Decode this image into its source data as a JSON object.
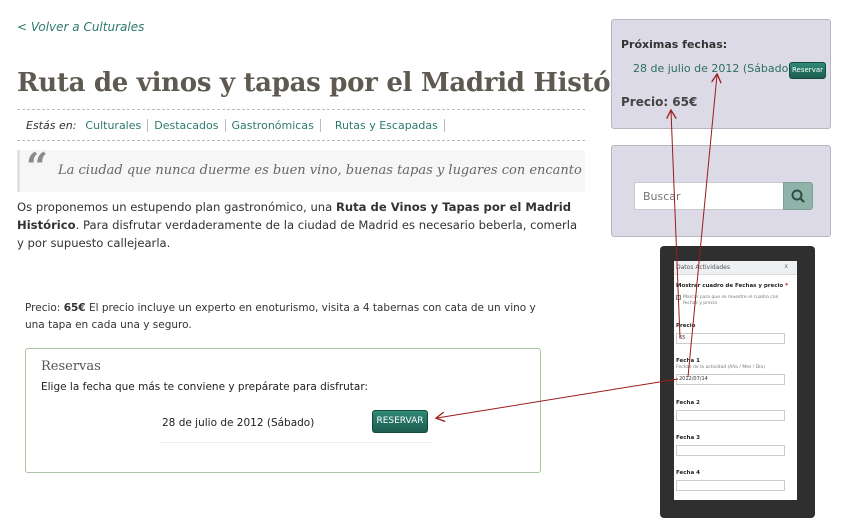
{
  "nav": {
    "back_link": "< Volver a Culturales"
  },
  "article": {
    "title": "Ruta de vinos y tapas por el Madrid Histórico",
    "categories_label": "Estás en:",
    "categories": [
      "Culturales",
      "Destacados",
      "Gastronómicas",
      "Rutas y Escapadas"
    ],
    "quote": "La ciudad que nunca duerme es buen vino, buenas tapas y lugares con encanto",
    "intro_a": "Os proponemos un estupendo plan gastronómico, una ",
    "intro_bold": "Ruta de Vinos y Tapas por el Madrid Histórico",
    "intro_b": ". Para disfrutar verdaderamente de la ciudad de Madrid es necesario beberla, comerla y por supuesto callejearla.",
    "price_label": "Precio: ",
    "price_value": "65€",
    "price_desc": " El precio incluye un experto en enoturismo, visita a 4 tabernas con cata de un vino y una tapa en cada una y seguro."
  },
  "reservas": {
    "title": "Reservas",
    "subtitle": "Elige la fecha que más te conviene y prepárate para disfrutar:",
    "date": "28 de julio de 2012 (Sábado)",
    "button": "RESERVAR"
  },
  "sidebar": {
    "next_dates_title": "Próximas fechas:",
    "date": "28 de julio de 2012 (Sábado)",
    "button": "Reservar",
    "price": "Precio: 65€",
    "search_placeholder": "Buscar"
  },
  "admin_panel": {
    "header": "Datos Actividades",
    "close": "x",
    "show_box_label": "Mostrar cuadro de Fechas y precio",
    "required_mark": "*",
    "checkbox_text_1": "Marcar para que se muestre el cuadro con",
    "checkbox_text_2": "fechas y precio",
    "price_label": "Precio",
    "price_value": "65",
    "fecha1_label": "Fecha 1",
    "fecha1_help": "Fechas de la actividad (Año / Mes / Día)",
    "fecha1_value": "2012/07/14",
    "fecha2_label": "Fecha 2",
    "fecha3_label": "Fecha 3",
    "fecha4_label": "Fecha 4"
  },
  "colors": {
    "link": "#2d7a6e",
    "button": "#1d5c4e",
    "sidebar_bg": "#dcdae6",
    "arrow": "#9b1b1b",
    "tablet": "#2f2f2f"
  },
  "icons": {
    "search": "search-icon",
    "quote": "quote-icon"
  }
}
